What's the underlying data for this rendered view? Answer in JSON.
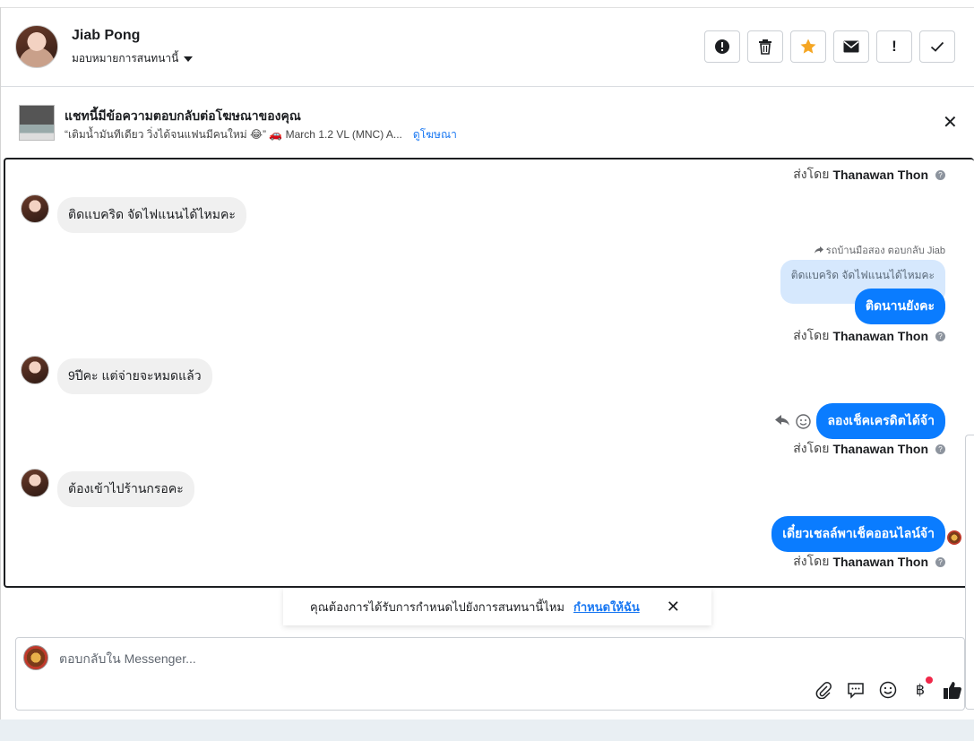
{
  "header": {
    "name": "Jiab Pong",
    "assign_label": "มอบหมายการสนทนานี้",
    "buttons": [
      {
        "label": "!",
        "icon": "alert-circle-icon"
      },
      {
        "label": "🗑",
        "icon": "trash-icon"
      },
      {
        "label": "★",
        "icon": "star-icon"
      },
      {
        "label": "✉",
        "icon": "envelope-icon"
      },
      {
        "label": "!",
        "icon": "exclamation-icon"
      },
      {
        "label": "✓",
        "icon": "check-icon"
      }
    ]
  },
  "ad": {
    "title": "แชทนี้มีข้อความตอบกลับต่อโฆษณาของคุณ",
    "subtitle": "“เติมน้ำมันทีเดียว วิ่งได้จนแฟนมีคนใหม่ 😂” 🚗 March 1.2 VL (MNC) A...",
    "link": "ดูโฆษณา",
    "close": "✕"
  },
  "messages": {
    "sent_prefix": "ส่งโดย",
    "sender": "Thanawan Thon",
    "help_glyph": "?",
    "incoming": [
      "ติดแบคริด จัดไฟแนนได้ไหมคะ",
      "9ปีคะ  แต่จ่ายจะหมดแล้ว",
      "ต้องเข้าไปร้านกรอคะ"
    ],
    "reply_meta": "รถบ้านมือสอง ตอบกลับ Jiab",
    "reply_quote": "ติดแบคริด จัดไฟแนนได้ไหมคะ",
    "outgoing": [
      "ติดนานยังคะ",
      "ลองเช็คเครดิตได้จ้า",
      "เดี๋ยวเชลล์พาเช็คออนไลน์จ้า"
    ]
  },
  "toast": {
    "text": "คุณต้องการได้รับการกำหนดไปยังการสนทนานี้ไหม",
    "link": "กำหนดให้ฉัน",
    "close": "✕"
  },
  "composer": {
    "placeholder": "ตอบกลับใน Messenger...",
    "baht": "฿"
  },
  "colors": {
    "accent": "#0a7cff",
    "link": "#1877f2",
    "star": "#f5a623",
    "incoming_bg": "#f0f0f0",
    "quote_bg": "#d6e8fd"
  }
}
